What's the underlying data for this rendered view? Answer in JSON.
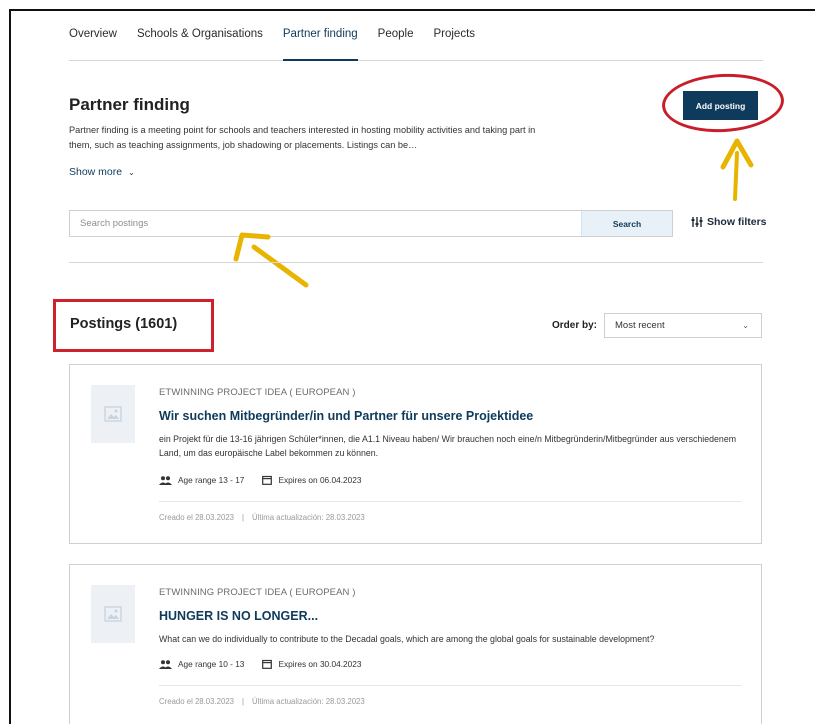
{
  "nav": {
    "tabs": [
      {
        "label": "Overview"
      },
      {
        "label": "Schools & Organisations"
      },
      {
        "label": "Partner finding"
      },
      {
        "label": "People"
      },
      {
        "label": "Projects"
      }
    ]
  },
  "page": {
    "title": "Partner finding",
    "description": "Partner finding is a meeting point for schools and teachers interested in hosting mobility activities and taking part in them, such as teaching assignments, job shadowing or placements. Listings can be…",
    "show_more": "Show more",
    "add_posting": "Add posting"
  },
  "search": {
    "placeholder": "Search postings",
    "button": "Search",
    "filters": "Show filters"
  },
  "postings": {
    "title": "Postings (1601)",
    "order_label": "Order by:",
    "order_value": "Most recent"
  },
  "cards": [
    {
      "kicker": "ETWINNING PROJECT IDEA ( EUROPEAN )",
      "title": "Wir suchen Mitbegründer/in und Partner für unsere Projektidee",
      "description": "ein Projekt für die 13-16 jährigen Schüler*innen, die A1.1 Niveau haben/ Wir brauchen noch eine/n Mitbegründerin/Mitbegründer aus verschiedenem Land, um das europäische Label bekommen zu können.",
      "age": "Age range 13 - 17",
      "expires": "Expires on 06.04.2023",
      "created": "Creado el 28.03.2023",
      "separator": "|",
      "updated": "Última actualización: 28.03.2023"
    },
    {
      "kicker": "ETWINNING PROJECT IDEA ( EUROPEAN )",
      "title": "HUNGER IS NO LONGER...",
      "description": "What can we do individually to contribute to the Decadal goals, which are among the global goals for sustainable development?",
      "age": "Age range 10 - 13",
      "expires": "Expires on 30.04.2023",
      "created": "Creado el 28.03.2023",
      "separator": "|",
      "updated": "Última actualización: 28.03.2023"
    }
  ],
  "colors": {
    "accent": "#0e3a5b",
    "annotation_red": "#d0202c",
    "annotation_arrow": "#e8b400"
  }
}
